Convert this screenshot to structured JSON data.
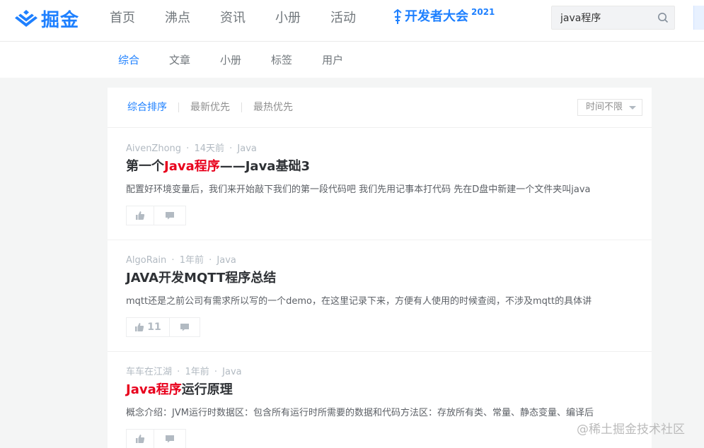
{
  "brand": {
    "name": "掘金",
    "color": "#1e80ff"
  },
  "main_nav": [
    "首页",
    "沸点",
    "资讯",
    "小册",
    "活动"
  ],
  "conference": {
    "label": "开发者大会",
    "year": "2021"
  },
  "search": {
    "value": "java程序",
    "placeholder": ""
  },
  "sub_tabs": [
    {
      "label": "综合",
      "active": true
    },
    {
      "label": "文章",
      "active": false
    },
    {
      "label": "小册",
      "active": false
    },
    {
      "label": "标签",
      "active": false
    },
    {
      "label": "用户",
      "active": false
    }
  ],
  "sort": {
    "options": [
      "综合排序",
      "最新优先",
      "最热优先"
    ],
    "active_index": 0,
    "time_filter": "时间不限"
  },
  "results": [
    {
      "author": "AivenZhong",
      "time": "14天前",
      "tag": "Java",
      "title_before": "第一个",
      "title_highlight": "Java程序",
      "title_after": "——Java基础3",
      "excerpt": "配置好环境变量后，我们来开始敲下我们的第一段代码吧 我们先用记事本打代码 先在D盘中新建一个文件夹叫java",
      "likes": ""
    },
    {
      "author": "AlgoRain",
      "time": "1年前",
      "tag": "Java",
      "title_before": "JAVA开发MQTT程序总结",
      "title_highlight": "",
      "title_after": "",
      "excerpt": "mqtt还是之前公司有需求所以写的一个demo，在这里记录下来，方便有人使用的时候查阅，不涉及mqtt的具体讲",
      "likes": "11"
    },
    {
      "author": "车车在江湖",
      "time": "1年前",
      "tag": "Java",
      "title_before": "",
      "title_highlight": "Java程序",
      "title_after": "运行原理",
      "excerpt": "概念介绍：JVM运行时数据区：包含所有运行时所需要的数据和代码方法区：存放所有类、常量、静态变量、编译后",
      "likes": ""
    }
  ],
  "meta_separator": "·",
  "watermark": "@稀土掘金技术社区",
  "colors": {
    "accent": "#1e80ff",
    "highlight": "#e8001c",
    "muted": "#b2bac2"
  }
}
